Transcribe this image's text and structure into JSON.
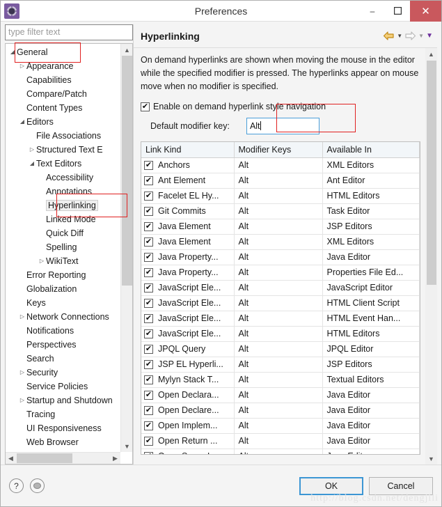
{
  "window": {
    "title": "Preferences",
    "app_icon": "eclipse-gear-icon",
    "minimize_label": "–",
    "maximize_label": "❑",
    "close_label": "✕"
  },
  "sidebar": {
    "filter_placeholder": "type filter text",
    "filter_value": "",
    "items": [
      {
        "label": "General",
        "indent": 0,
        "twisty": "expanded"
      },
      {
        "label": "Appearance",
        "indent": 1,
        "twisty": "collapsed"
      },
      {
        "label": "Capabilities",
        "indent": 1,
        "twisty": "none"
      },
      {
        "label": "Compare/Patch",
        "indent": 1,
        "twisty": "none"
      },
      {
        "label": "Content Types",
        "indent": 1,
        "twisty": "none"
      },
      {
        "label": "Editors",
        "indent": 1,
        "twisty": "expanded"
      },
      {
        "label": "File Associations",
        "indent": 2,
        "twisty": "none"
      },
      {
        "label": "Structured Text E",
        "indent": 2,
        "twisty": "collapsed"
      },
      {
        "label": "Text Editors",
        "indent": 2,
        "twisty": "expanded"
      },
      {
        "label": "Accessibility",
        "indent": 3,
        "twisty": "none"
      },
      {
        "label": "Annotations",
        "indent": 3,
        "twisty": "none"
      },
      {
        "label": "Hyperlinking",
        "indent": 3,
        "twisty": "none",
        "selected": true
      },
      {
        "label": "Linked Mode",
        "indent": 3,
        "twisty": "none"
      },
      {
        "label": "Quick Diff",
        "indent": 3,
        "twisty": "none"
      },
      {
        "label": "Spelling",
        "indent": 3,
        "twisty": "none"
      },
      {
        "label": "WikiText",
        "indent": 3,
        "twisty": "collapsed"
      },
      {
        "label": "Error Reporting",
        "indent": 1,
        "twisty": "none"
      },
      {
        "label": "Globalization",
        "indent": 1,
        "twisty": "none"
      },
      {
        "label": "Keys",
        "indent": 1,
        "twisty": "none"
      },
      {
        "label": "Network Connections",
        "indent": 1,
        "twisty": "collapsed"
      },
      {
        "label": "Notifications",
        "indent": 1,
        "twisty": "none"
      },
      {
        "label": "Perspectives",
        "indent": 1,
        "twisty": "none"
      },
      {
        "label": "Search",
        "indent": 1,
        "twisty": "none"
      },
      {
        "label": "Security",
        "indent": 1,
        "twisty": "collapsed"
      },
      {
        "label": "Service Policies",
        "indent": 1,
        "twisty": "none"
      },
      {
        "label": "Startup and Shutdown",
        "indent": 1,
        "twisty": "collapsed"
      },
      {
        "label": "Tracing",
        "indent": 1,
        "twisty": "none"
      },
      {
        "label": "UI Responsiveness",
        "indent": 1,
        "twisty": "none"
      },
      {
        "label": "Web Browser",
        "indent": 1,
        "twisty": "none"
      }
    ]
  },
  "page": {
    "title": "Hyperlinking",
    "nav": {
      "back_icon": "back-arrow-icon",
      "back_caret": "▼",
      "forward_icon": "forward-arrow-icon",
      "forward_caret": "▼",
      "menu_caret": "▼"
    },
    "description": "On demand hyperlinks are shown when moving the mouse in the editor while the specified modifier is pressed. The hyperlinks appear on mouse move when no modifier is specified.",
    "enable_checkbox": {
      "label": "Enable on demand hyperlink style navigation",
      "checked": true,
      "check_glyph": "✔"
    },
    "modifier": {
      "label": "Default modifier key:",
      "value": "Alt"
    }
  },
  "table": {
    "columns": [
      "Link Kind",
      "Modifier Keys",
      "Available In"
    ],
    "rows": [
      {
        "checked": true,
        "kind": "Anchors",
        "modifier": "Alt",
        "available": "XML Editors"
      },
      {
        "checked": true,
        "kind": "Ant Element",
        "modifier": "Alt",
        "available": "Ant Editor"
      },
      {
        "checked": true,
        "kind": "Facelet EL Hy...",
        "modifier": "Alt",
        "available": "HTML Editors"
      },
      {
        "checked": true,
        "kind": "Git Commits",
        "modifier": "Alt",
        "available": "Task Editor"
      },
      {
        "checked": true,
        "kind": "Java Element",
        "modifier": "Alt",
        "available": "JSP Editors"
      },
      {
        "checked": true,
        "kind": "Java Element",
        "modifier": "Alt",
        "available": "XML Editors"
      },
      {
        "checked": true,
        "kind": "Java Property...",
        "modifier": "Alt",
        "available": "Java Editor"
      },
      {
        "checked": true,
        "kind": "Java Property...",
        "modifier": "Alt",
        "available": "Properties File Ed..."
      },
      {
        "checked": true,
        "kind": "JavaScript Ele...",
        "modifier": "Alt",
        "available": "JavaScript Editor"
      },
      {
        "checked": true,
        "kind": "JavaScript Ele...",
        "modifier": "Alt",
        "available": "HTML Client Script"
      },
      {
        "checked": true,
        "kind": "JavaScript Ele...",
        "modifier": "Alt",
        "available": "HTML Event Han..."
      },
      {
        "checked": true,
        "kind": "JavaScript Ele...",
        "modifier": "Alt",
        "available": "HTML Editors"
      },
      {
        "checked": true,
        "kind": "JPQL Query",
        "modifier": "Alt",
        "available": "JPQL Editor"
      },
      {
        "checked": true,
        "kind": "JSP EL Hyperli...",
        "modifier": "Alt",
        "available": "JSP Editors"
      },
      {
        "checked": true,
        "kind": "Mylyn Stack T...",
        "modifier": "Alt",
        "available": "Textual Editors"
      },
      {
        "checked": true,
        "kind": "Open Declara...",
        "modifier": "Alt",
        "available": "Java Editor"
      },
      {
        "checked": true,
        "kind": "Open Declare...",
        "modifier": "Alt",
        "available": "Java Editor"
      },
      {
        "checked": true,
        "kind": "Open Implem...",
        "modifier": "Alt",
        "available": "Java Editor"
      },
      {
        "checked": true,
        "kind": "Open Return ...",
        "modifier": "Alt",
        "available": "Java Editor"
      },
      {
        "checked": true,
        "kind": "Open Super I...",
        "modifier": "Alt",
        "available": "Java Editor"
      }
    ],
    "check_glyph": "✔"
  },
  "footer": {
    "help_icon": "question-mark-icon",
    "help_glyph": "?",
    "apply_icon": "apply-defaults-icon",
    "ok_label": "OK",
    "cancel_label": "Cancel"
  },
  "watermark": "http://blog.csdn.net/dengjili",
  "colors": {
    "accent_blue": "#3c96d4",
    "close_red": "#c9585d",
    "annotation_red": "#e02020",
    "app_purple": "#7a5ba0",
    "back_arrow_orange": "#e8a33d"
  }
}
